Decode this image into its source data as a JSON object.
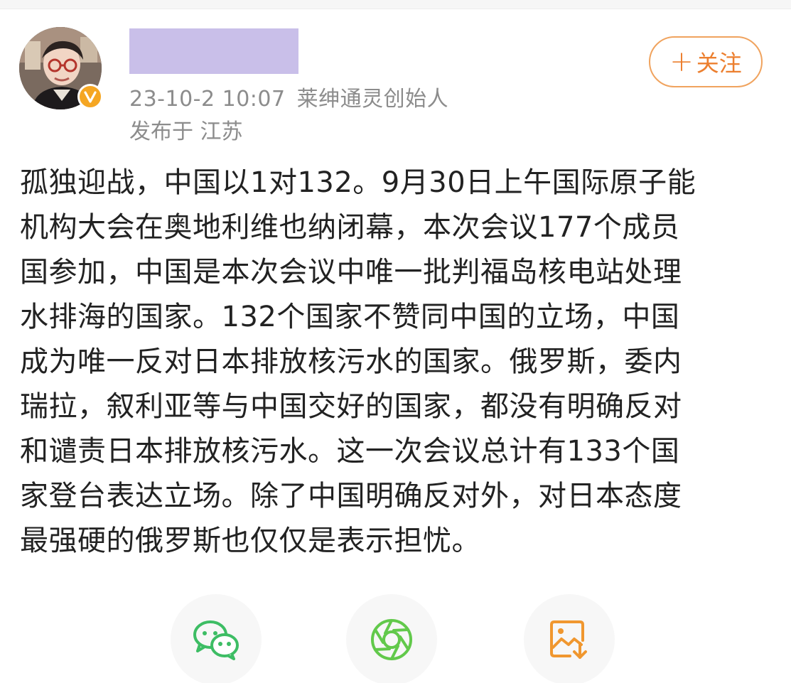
{
  "header": {
    "meta": {
      "timestamp": "23-10-2 10:07",
      "source": "莱绅通灵创始人"
    },
    "location": "发布于 江苏",
    "follow_button": {
      "plus": "+",
      "label": "关注"
    }
  },
  "post": {
    "lines": [
      "孤独迎战，中国以1对132。9月30日上午国际原子能",
      "机构大会在奥地利维也纳闭幕，本次会议177个成员",
      "国参加，中国是本次会议中唯一批判福岛核电站处理",
      "水排海的国家。132个国家不赞同中国的立场，中国",
      "成为唯一反对日本排放核污水的国家。俄罗斯，委内",
      "瑞拉，叙利亚等与中国交好的国家，都没有明确反对",
      "和谴责日本排放核污水。这一次会议总计有133个国",
      "家登台表达立场。除了中国明确反对外，对日本态度",
      "最强硬的俄罗斯也仅仅是表示担忧。"
    ]
  },
  "share": {
    "icons": [
      "wechat-icon",
      "moments-icon",
      "save-image-icon"
    ]
  },
  "colors": {
    "accent": "#ec7f2f",
    "follow_border": "#f0a35e",
    "wechat_green": "#3dbd64",
    "moments_green": "#62c94b",
    "save_orange": "#f0972f",
    "redaction": "#c9bfe9",
    "meta_gray": "#8c8c8c",
    "text": "#222222"
  }
}
